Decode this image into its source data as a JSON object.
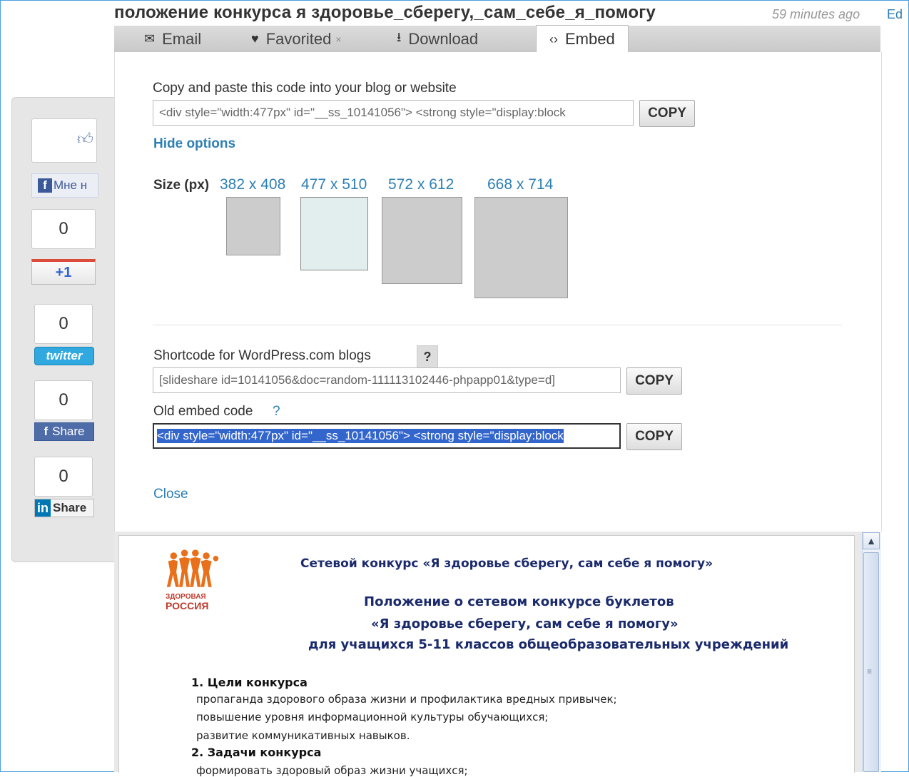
{
  "header": {
    "title": "положение конкурса я здоровье_сберегу,_сам_себе_я_помогу",
    "time": "59 minutes ago",
    "edit_cut": "Ed"
  },
  "tabs": [
    {
      "label": "Email",
      "icon": "envelope-icon"
    },
    {
      "label": "Favorited",
      "icon": "heart-icon",
      "remove": "×"
    },
    {
      "label": "Download",
      "icon": "download-icon"
    },
    {
      "label": "Embed",
      "icon": "code-icon",
      "active": true
    }
  ],
  "social": {
    "fb_like_label": "Мне н",
    "gplus_count": "0",
    "gplus_label": "+1",
    "twitter_count": "0",
    "twitter_label": "twitter",
    "fb_share_count": "0",
    "fb_share_label": "Share",
    "linkedin_count": "0",
    "linkedin_logo": "in",
    "linkedin_label": "Share"
  },
  "embed": {
    "copy_label": "Copy and paste this code into your blog or website",
    "embed_code": "<div style=\"width:477px\" id=\"__ss_10141056\"> <strong style=\"display:block",
    "copy_button": "COPY",
    "hide_options": "Hide options",
    "size_label": "Size (px)",
    "sizes": [
      "382 x 408",
      "477 x 510",
      "572 x 612",
      "668 x 714"
    ],
    "selected_size": "477 x 510",
    "shortcode_label": "Shortcode for WordPress.com blogs",
    "shortcode_help": "?",
    "shortcode": "[slideshare id=10141056&doc=random-111113102446-phpapp01&type=d]",
    "old_label": "Old embed code",
    "old_help": "?",
    "old_code": "<div style=\"width:477px\" id=\"__ss_10141056\"> <strong style=\"display:block",
    "close": "Close"
  },
  "slide": {
    "logo_text_1": "ЗДОРОВАЯ",
    "logo_text_2": "РОССИЯ",
    "line1": "Сетевой конкурс «Я здоровье сберегу, сам себе я помогу»",
    "line2": "Положение о сетевом конкурсе буклетов",
    "line3": "«Я здоровье сберегу, сам себе я помогу»",
    "line4": "для учащихся 5-11 классов общеобразовательных учреждений",
    "section1": "1. Цели конкурса",
    "item1": "пропаганда здорового образа жизни и профилактика вредных привычек;",
    "item2": "повышение уровня информационной культуры обучающихся;",
    "item3": "развитие коммуникативных навыков.",
    "section2": "2. Задачи конкурса",
    "item4": "формировать здоровый образ жизни учащихся;"
  }
}
